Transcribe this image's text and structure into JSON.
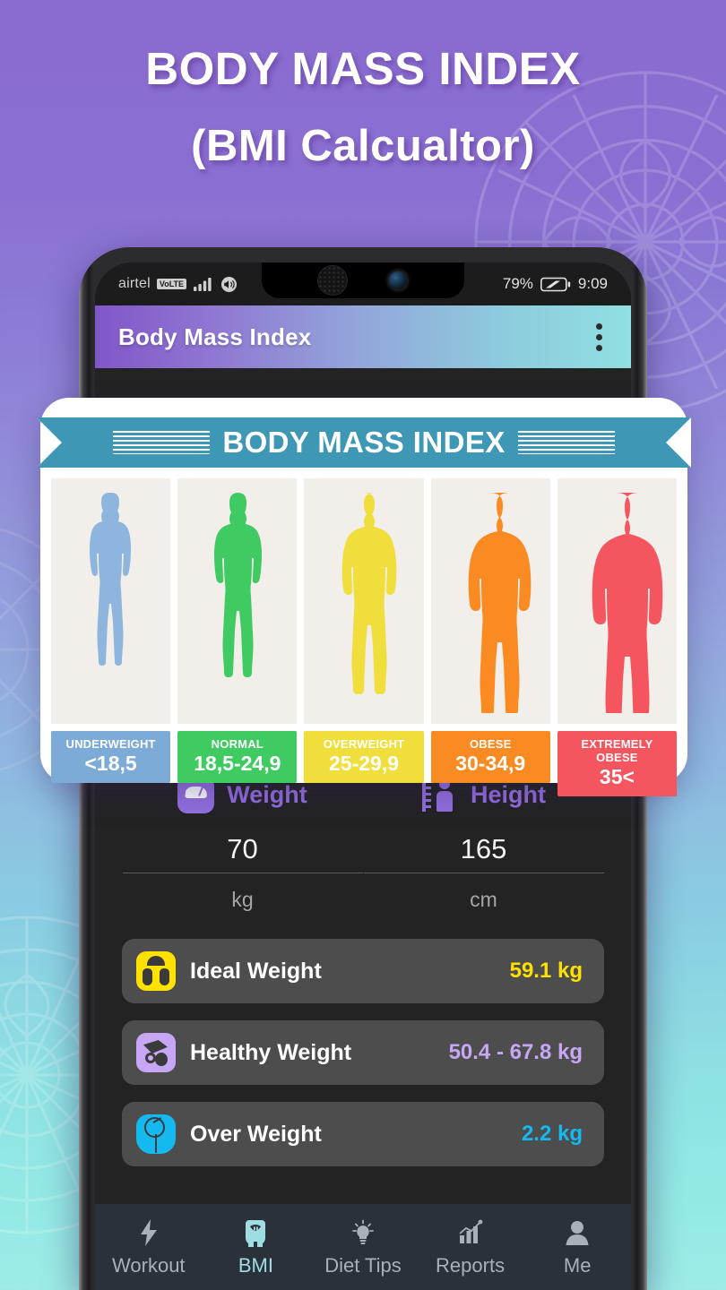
{
  "poster": {
    "title_line1": "BODY MASS INDEX",
    "title_line2": "(BMI Calcualtor)",
    "bg_top_color": "#8a6bd0",
    "bg_bottom_color": "#9cece7"
  },
  "status_bar": {
    "carrier": "airtel",
    "volte": "VoLTE",
    "signal_icon": "signal-bars-icon",
    "call_icon": "call-volume-icon",
    "battery_percent": "79%",
    "battery_icon": "battery-icon",
    "time": "9:09"
  },
  "app_bar": {
    "title": "Body Mass Index",
    "menu_icon": "kebab-menu-icon",
    "gradient_start": "#8156c9",
    "gradient_end": "#8fe0e1"
  },
  "bmi_card": {
    "ribbon_title": "BODY MASS INDEX",
    "ribbon_color": "#3e97b4",
    "categories": [
      {
        "name": "UNDERWEIGHT",
        "range": "<18,5",
        "color": "#7cabd8",
        "figure_icon": "body-underweight-icon"
      },
      {
        "name": "NORMAL",
        "range": "18,5-24,9",
        "color": "#3fca62",
        "figure_icon": "body-normal-icon"
      },
      {
        "name": "OVERWEIGHT",
        "range": "25-29,9",
        "color": "#f0de3c",
        "figure_icon": "body-overweight-icon"
      },
      {
        "name": "OBESE",
        "range": "30-34,9",
        "color": "#fa8a22",
        "figure_icon": "body-obese-icon"
      },
      {
        "name": "EXTREMELY OBESE",
        "range": "35<",
        "color": "#f4555e",
        "figure_icon": "body-extremely-obese-icon"
      }
    ]
  },
  "inputs": {
    "weight": {
      "label": "Weight",
      "value": "70",
      "unit": "kg",
      "icon": "weight-scale-icon"
    },
    "height": {
      "label": "Height",
      "value": "165",
      "unit": "cm",
      "icon": "height-ruler-icon"
    },
    "accent_color": "#9370e0"
  },
  "results": [
    {
      "label": "Ideal Weight",
      "value": "59.1 kg",
      "value_color": "#ffe100",
      "icon": "ideal-weight-scale-icon",
      "icon_bg": "#ffe100"
    },
    {
      "label": "Healthy Weight",
      "value": "50.4 - 67.8 kg",
      "value_color": "#c7a7f5",
      "icon": "healthy-weight-food-icon",
      "icon_bg": "#c7a7f5"
    },
    {
      "label": "Over Weight",
      "value": "2.2 kg",
      "value_color": "#14b9f0",
      "icon": "over-weight-scale-icon",
      "icon_bg": "#14b9f0"
    }
  ],
  "bottom_nav": {
    "active": "BMI",
    "items": [
      {
        "label": "Workout",
        "icon": "lightning-bolt-icon"
      },
      {
        "label": "BMI",
        "icon": "bmi-scale-icon"
      },
      {
        "label": "Diet Tips",
        "icon": "lightbulb-icon"
      },
      {
        "label": "Reports",
        "icon": "bar-chart-icon"
      },
      {
        "label": "Me",
        "icon": "person-icon"
      }
    ],
    "active_color": "#9fdde3",
    "inactive_color": "#a9b0b8"
  }
}
